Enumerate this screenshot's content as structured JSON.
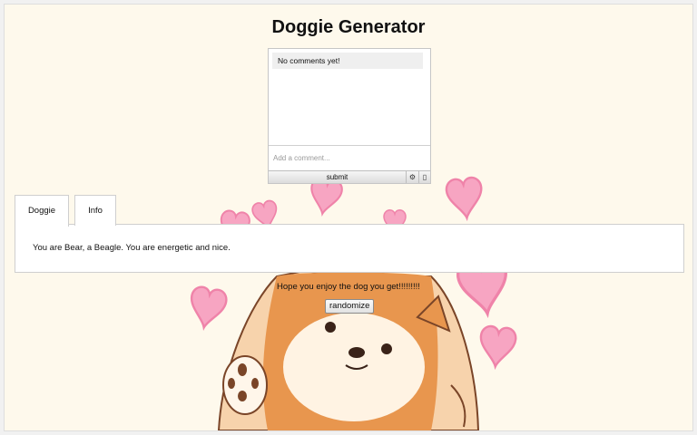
{
  "page": {
    "title": "Doggie Generator"
  },
  "comments": {
    "items": [
      "No comments yet!"
    ],
    "input_placeholder": "Add a comment...",
    "submit_label": "submit",
    "settings_icon": "gear-icon",
    "info_icon": "info-icon"
  },
  "tabs": [
    {
      "label": "Doggie",
      "selected": true
    },
    {
      "label": "Info",
      "selected": false
    }
  ],
  "panel": {
    "text": "You are Bear, a Beagle. You are energetic and nice."
  },
  "footer": {
    "message": "Hope you enjoy the dog you get!!!!!!!!!",
    "randomize_label": "randomize"
  },
  "colors": {
    "background": "#fef9ec",
    "heart": "#f59ab8",
    "dog_fur": "#e8964e"
  }
}
